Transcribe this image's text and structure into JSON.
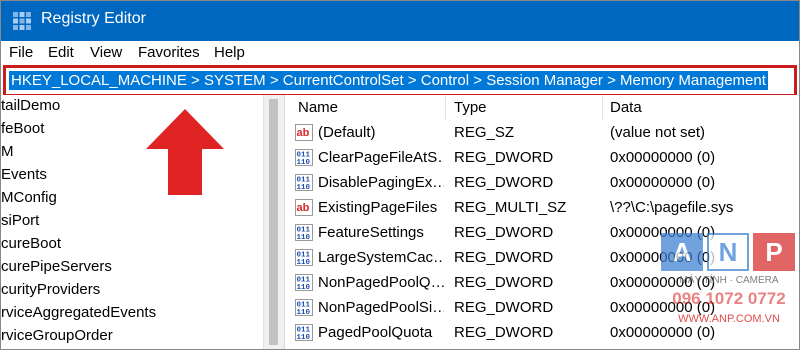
{
  "window": {
    "title": "Registry Editor",
    "icon": "registry-editor-icon"
  },
  "menu": [
    "File",
    "Edit",
    "View",
    "Favorites",
    "Help"
  ],
  "address": {
    "path": "HKEY_LOCAL_MACHINE > SYSTEM > CurrentControlSet > Control > Session Manager > Memory Management"
  },
  "tree": {
    "items": [
      "tailDemo",
      "feBoot",
      "M",
      "Events",
      "MConfig",
      "siPort",
      "cureBoot",
      "curePipeServers",
      "curityProviders",
      "rviceAggregatedEvents",
      "rviceGroupOrder"
    ]
  },
  "list": {
    "columns": {
      "name": "Name",
      "type": "Type",
      "data": "Data"
    },
    "rows": [
      {
        "name": "(Default)",
        "type": "REG_SZ",
        "data": "(value not set)",
        "icon": "string-value-icon"
      },
      {
        "name": "ClearPageFileAtS…",
        "type": "REG_DWORD",
        "data": "0x00000000 (0)",
        "icon": "binary-value-icon"
      },
      {
        "name": "DisablePagingEx…",
        "type": "REG_DWORD",
        "data": "0x00000000 (0)",
        "icon": "binary-value-icon"
      },
      {
        "name": "ExistingPageFiles",
        "type": "REG_MULTI_SZ",
        "data": "\\??\\C:\\pagefile.sys",
        "icon": "string-value-icon"
      },
      {
        "name": "FeatureSettings",
        "type": "REG_DWORD",
        "data": "0x00000000 (0)",
        "icon": "binary-value-icon"
      },
      {
        "name": "LargeSystemCac…",
        "type": "REG_DWORD",
        "data": "0x00000000 (0)",
        "icon": "binary-value-icon"
      },
      {
        "name": "NonPagedPoolQ…",
        "type": "REG_DWORD",
        "data": "0x00000000 (0)",
        "icon": "binary-value-icon"
      },
      {
        "name": "NonPagedPoolSi…",
        "type": "REG_DWORD",
        "data": "0x00000000 (0)",
        "icon": "binary-value-icon"
      },
      {
        "name": "PagedPoolQuota",
        "type": "REG_DWORD",
        "data": "0x00000000 (0)",
        "icon": "binary-value-icon"
      }
    ]
  },
  "watermark": {
    "letters": [
      "A",
      "N",
      "P"
    ],
    "tagline": "MÁY TÍNH · CAMERA",
    "phone": "096 1072 0772",
    "site": "WWW.ANP.COM.VN"
  },
  "colors": {
    "titlebar": "#0067c0",
    "selection": "#0078d7",
    "annotation": "#cc1b1b"
  }
}
